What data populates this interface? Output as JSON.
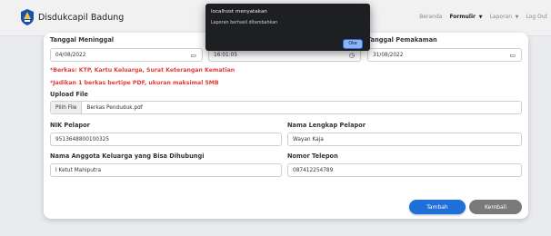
{
  "navbar": {
    "brand": "Disdukcapil Badung",
    "links": [
      {
        "label": "Beranda",
        "active": false,
        "dropdown": false
      },
      {
        "label": "Formulir",
        "active": true,
        "dropdown": true
      },
      {
        "label": "Laporan",
        "active": false,
        "dropdown": true
      },
      {
        "label": "Log Out",
        "active": false,
        "dropdown": false
      }
    ]
  },
  "form": {
    "tanggal_meninggal": {
      "label": "Tanggal Meninggal",
      "value": "04/08/2022"
    },
    "jam": {
      "value": "16:01:05"
    },
    "tanggal_pemakaman": {
      "label": "Tanggal Pemakaman",
      "value": "31/08/2022"
    },
    "notes": [
      "*Berkas: KTP, Kartu Keluarga, Surat Keterangan Kematian",
      "*Jadikan 1 berkas bertipe PDF, ukuran maksimal 5MB"
    ],
    "upload": {
      "label": "Upload File",
      "button": "Pilih File",
      "filename": "Berkas Penduduk.pdf"
    },
    "nik_pelapor": {
      "label": "NIK Pelapor",
      "value": "9513648800100325"
    },
    "nama_pelapor": {
      "label": "Nama Lengkap Pelapor",
      "value": "Wayan Kaja"
    },
    "anggota_keluarga": {
      "label": "Nama Anggota Keluarga yang Bisa Dihubungi",
      "value": "I Ketut Mahiputra"
    },
    "nomor_telepon": {
      "label": "Nomor Telepon",
      "value": "087412254789"
    },
    "buttons": {
      "add": "Tambah",
      "back": "Kembali"
    }
  },
  "dialog": {
    "title": "localhost menyatakan",
    "message": "Laporan berhasil ditambahkan",
    "ok": "Oke"
  },
  "colors": {
    "primary": "#1e6fd9",
    "danger": "#e53935",
    "secondary": "#7a7a7a"
  }
}
